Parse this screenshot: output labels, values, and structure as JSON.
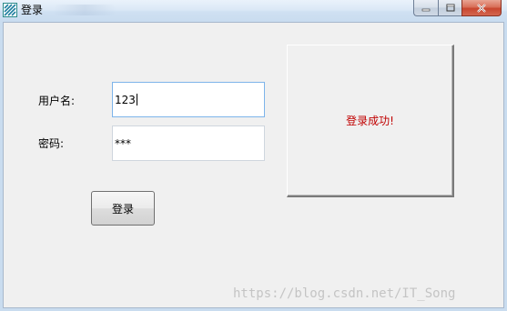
{
  "window": {
    "title": "登录",
    "app_icon": "stripes-app-icon",
    "caption_buttons": [
      "minimize-icon",
      "maximize-icon",
      "close-icon"
    ]
  },
  "form": {
    "username_label": "用户名:",
    "username_value": "123",
    "password_label": "密码:",
    "password_value": "***",
    "login_button_label": "登录"
  },
  "result": {
    "message": "登录成功!",
    "message_color": "#c00000"
  },
  "watermark": {
    "text": "https://blog.csdn.net/IT_Song"
  }
}
